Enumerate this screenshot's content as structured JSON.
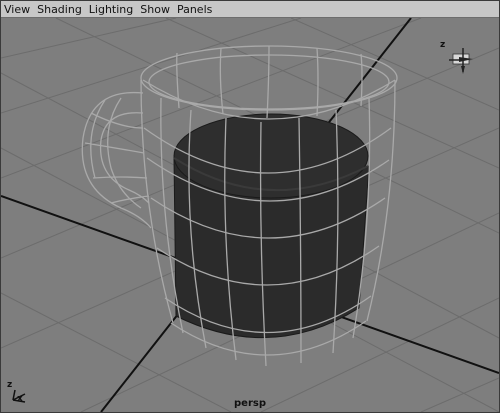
{
  "menubar": {
    "items": [
      {
        "label": "View"
      },
      {
        "label": "Shading"
      },
      {
        "label": "Lighting"
      },
      {
        "label": "Show"
      },
      {
        "label": "Panels"
      }
    ]
  },
  "viewport": {
    "camera_name": "persp",
    "view_cube_axis": "z",
    "corner_axis_labels": {
      "z": "z",
      "x": "x"
    }
  },
  "colors": {
    "menubar_bg": "#c7c7c7",
    "viewport_bg": "#7e7e7e",
    "grid": "#6c6c6c",
    "grid_axis": "#111111",
    "wireframe": "#a9a9a9",
    "solid_mesh": "#2b2b2b"
  }
}
